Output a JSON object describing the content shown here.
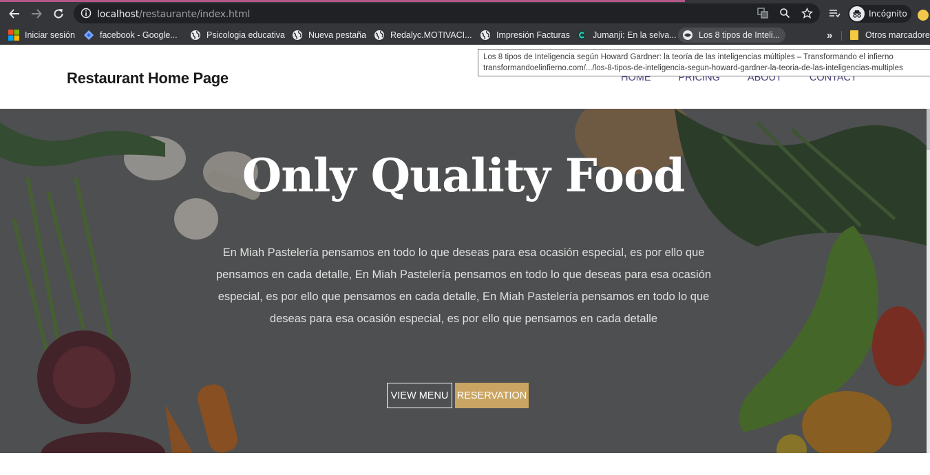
{
  "browser": {
    "url_host": "localhost",
    "url_path": "/restaurante/index.html",
    "profile_label": "Incógnito",
    "bookmarks": [
      {
        "label": "Iniciar sesión",
        "icon": "microsoft-logo-icon"
      },
      {
        "label": "facebook - Google...",
        "icon": "google-drive-icon"
      },
      {
        "label": "Psicologia educativa",
        "icon": "globe-icon"
      },
      {
        "label": "Nueva pestaña",
        "icon": "globe-icon"
      },
      {
        "label": "Redalyc.MOTIVACI...",
        "icon": "globe-icon"
      },
      {
        "label": "Impresión Facturas",
        "icon": "globe-icon"
      },
      {
        "label": "Jumanji: En la selva...",
        "icon": "c-logo-icon"
      },
      {
        "label": "Los 8 tipos de Inteli...",
        "icon": "loading-globe-icon"
      }
    ],
    "more_bookmarks": "»",
    "other_bookmarks": "Otros marcadores",
    "tooltip": {
      "title": "Los 8 tipos de Inteligencia según Howard Gardner: la teoría de las inteligencias múltiples – Transformando el infierno",
      "url": "transformandoelinfierno.com/.../los-8-tipos-de-inteligencia-segun-howard-gardner-la-teoria-de-las-inteligencias-multiples"
    }
  },
  "site": {
    "brand": "Restaurant Home Page",
    "nav": [
      "HOME",
      "PRICING",
      "ABOUT",
      "CONTACT"
    ],
    "hero": {
      "title": "Only Quality Food",
      "text": "En Miah Pastelería pensamos en todo lo que deseas para esa ocasión especial, es por ello que pensamos en cada detalle, En Miah Pastelería pensamos en todo lo que deseas para esa ocasión especial, es por ello que pensamos en cada detalle, En Miah Pastelería pensamos en todo lo que deseas para esa ocasión especial, es por ello que pensamos en cada detalle",
      "btn_menu": "VIEW MENU",
      "btn_reservation": "RESERVATION"
    }
  },
  "colors": {
    "chrome_bg": "#35363a",
    "omnibox_bg": "#202124",
    "nav_link": "#4b3f7a",
    "gold_button": "#c9a462",
    "accent_line": "#b2588a"
  }
}
